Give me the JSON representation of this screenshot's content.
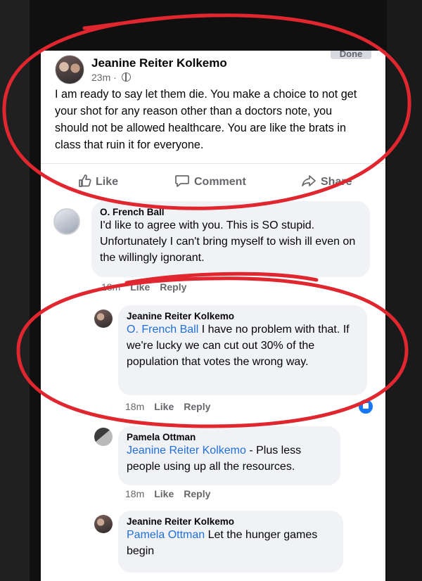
{
  "post": {
    "author": "Jeanine Reiter Kolkemo",
    "time": "23m",
    "top_button": "Done",
    "text": "I am ready to say let them die.  You make a choice to not get your shot for any reason other than a doctors note, you should not be allowed healthcare. You are like the brats in class that ruin it for everyone.",
    "actions": {
      "like": "Like",
      "comment": "Comment",
      "share": "Share"
    }
  },
  "comments": [
    {
      "author": "O. French Ball",
      "text": "I'd like to agree with you. This is SO stupid. Unfortunately I can't bring myself to wish ill even on the willingly ignorant.",
      "time": "18m",
      "like": "Like",
      "reply": "Reply"
    }
  ],
  "replies": [
    {
      "author": "Jeanine Reiter Kolkemo",
      "mention": "O. French Ball",
      "text": " I have no problem with that. If we're lucky we can cut out 30% of the population that votes the wrong way.",
      "time": "18m",
      "like": "Like",
      "reply": "Reply"
    },
    {
      "author": "Pamela Ottman",
      "mention": "Jeanine Reiter Kolkemo",
      "text": " - Plus less people using up all the resources.",
      "time": "18m",
      "like": "Like",
      "reply": "Reply"
    },
    {
      "author": "Jeanine Reiter Kolkemo",
      "mention": "Pamela Ottman",
      "text": " Let the hunger games begin"
    }
  ],
  "colors": {
    "annotation_red": "#e0262e",
    "mention_blue": "#216fdb",
    "bubble_gray": "#f0f2f5"
  }
}
